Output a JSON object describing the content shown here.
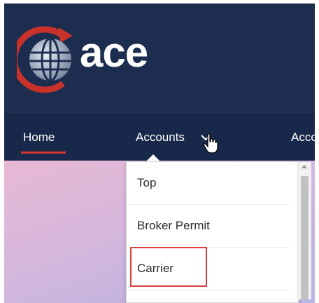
{
  "brand": {
    "logo_text": "ace"
  },
  "nav": {
    "items": [
      {
        "label": "Home"
      },
      {
        "label": "Accounts"
      },
      {
        "label": "Acco"
      }
    ]
  },
  "dropdown": {
    "items": [
      {
        "label": "Top"
      },
      {
        "label": "Broker Permit"
      },
      {
        "label": "Carrier"
      }
    ]
  },
  "colors": {
    "header_bg": "#1c2d4f",
    "active_underline": "#d63a32",
    "highlight_box": "#d9413a"
  },
  "icons": [
    "globe-logo-icon",
    "chevron-down-icon",
    "hand-pointer-cursor-icon",
    "scroll-up-arrow-icon"
  ]
}
